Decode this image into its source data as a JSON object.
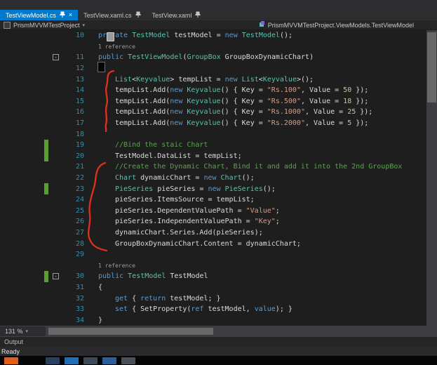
{
  "tabs": [
    {
      "label": "TestViewModel.cs",
      "active": true
    },
    {
      "label": "TestView.xaml.cs",
      "active": false
    },
    {
      "label": "TestView.xaml",
      "active": false
    }
  ],
  "breadcrumb": {
    "project": "PrismMVVMTestProject",
    "context": "PrismMVVMTestProject.ViewModels.TestViewModel"
  },
  "icons": {
    "close": "×",
    "caret": "▾",
    "fold_collapse": "-"
  },
  "editor": {
    "zoom_label": "131 %",
    "rows": [
      {
        "n": "10",
        "i": 0,
        "t": [
          [
            "kw",
            "private"
          ],
          [
            "pl",
            " "
          ],
          [
            "ty",
            "TestModel"
          ],
          [
            "pl",
            " testModel = "
          ],
          [
            "kw",
            "new"
          ],
          [
            "pl",
            " "
          ],
          [
            "ty",
            "TestModel"
          ],
          [
            "pl",
            "();"
          ]
        ]
      },
      {
        "lens": true,
        "i": 0,
        "text": "1 reference"
      },
      {
        "n": "11",
        "i": 0,
        "fold": true,
        "t": [
          [
            "kw",
            "public"
          ],
          [
            "pl",
            " "
          ],
          [
            "ty",
            "TestViewModel"
          ],
          [
            "pl",
            "("
          ],
          [
            "ty",
            "GroupBox"
          ],
          [
            "pl",
            " GroupBoxDynamicChart)"
          ]
        ]
      },
      {
        "n": "12",
        "i": 0,
        "t": [
          [
            "pl",
            "{"
          ]
        ]
      },
      {
        "n": "13",
        "i": 1,
        "t": [
          [
            "ty",
            "List"
          ],
          [
            "pl",
            "<"
          ],
          [
            "ty",
            "Keyvalue"
          ],
          [
            "pl",
            "> tempList = "
          ],
          [
            "kw",
            "new"
          ],
          [
            "pl",
            " "
          ],
          [
            "ty",
            "List"
          ],
          [
            "pl",
            "<"
          ],
          [
            "ty",
            "Keyvalue"
          ],
          [
            "pl",
            ">();"
          ]
        ]
      },
      {
        "n": "14",
        "i": 1,
        "t": [
          [
            "pl",
            "tempList.Add("
          ],
          [
            "kw",
            "new"
          ],
          [
            "pl",
            " "
          ],
          [
            "ty",
            "Keyvalue"
          ],
          [
            "pl",
            "() { Key = "
          ],
          [
            "st",
            "\"Rs.100\""
          ],
          [
            "pl",
            ", Value = "
          ],
          [
            "nu",
            "50"
          ],
          [
            "pl",
            " });"
          ]
        ]
      },
      {
        "n": "15",
        "i": 1,
        "t": [
          [
            "pl",
            "tempList.Add("
          ],
          [
            "kw",
            "new"
          ],
          [
            "pl",
            " "
          ],
          [
            "ty",
            "Keyvalue"
          ],
          [
            "pl",
            "() { Key = "
          ],
          [
            "st",
            "\"Rs.500\""
          ],
          [
            "pl",
            ", Value = "
          ],
          [
            "nu",
            "18"
          ],
          [
            "pl",
            " });"
          ]
        ]
      },
      {
        "n": "16",
        "i": 1,
        "t": [
          [
            "pl",
            "tempList.Add("
          ],
          [
            "kw",
            "new"
          ],
          [
            "pl",
            " "
          ],
          [
            "ty",
            "Keyvalue"
          ],
          [
            "pl",
            "() { Key = "
          ],
          [
            "st",
            "\"Rs.1000\""
          ],
          [
            "pl",
            ", Value = "
          ],
          [
            "nu",
            "25"
          ],
          [
            "pl",
            " });"
          ]
        ]
      },
      {
        "n": "17",
        "i": 1,
        "t": [
          [
            "pl",
            "tempList.Add("
          ],
          [
            "kw",
            "new"
          ],
          [
            "pl",
            " "
          ],
          [
            "ty",
            "Keyvalue"
          ],
          [
            "pl",
            "() { Key = "
          ],
          [
            "st",
            "\"Rs.2000\""
          ],
          [
            "pl",
            ", Value = "
          ],
          [
            "nu",
            "5"
          ],
          [
            "pl",
            " });"
          ]
        ]
      },
      {
        "n": "18",
        "i": 1,
        "t": []
      },
      {
        "n": "19",
        "i": 1,
        "green": true,
        "t": [
          [
            "co",
            "//Bind the staic Chart"
          ]
        ]
      },
      {
        "n": "20",
        "i": 1,
        "green": true,
        "t": [
          [
            "pl",
            "TestModel.DataList = tempList;"
          ]
        ]
      },
      {
        "n": "21",
        "i": 1,
        "t": [
          [
            "co",
            "//Create the Dynamic Chart, Bind it and add it into the 2nd GroupBox"
          ]
        ]
      },
      {
        "n": "22",
        "i": 1,
        "t": [
          [
            "ty",
            "Chart"
          ],
          [
            "pl",
            " dynamicChart = "
          ],
          [
            "kw",
            "new"
          ],
          [
            "pl",
            " "
          ],
          [
            "ty",
            "Chart"
          ],
          [
            "pl",
            "();"
          ]
        ]
      },
      {
        "n": "23",
        "i": 1,
        "green": true,
        "t": [
          [
            "ty",
            "PieSeries"
          ],
          [
            "pl",
            " pieSeries = "
          ],
          [
            "kw",
            "new"
          ],
          [
            "pl",
            " "
          ],
          [
            "ty",
            "PieSeries"
          ],
          [
            "pl",
            "();"
          ]
        ]
      },
      {
        "n": "24",
        "i": 1,
        "t": [
          [
            "pl",
            "pieSeries.ItemsSource = tempList;"
          ]
        ]
      },
      {
        "n": "25",
        "i": 1,
        "t": [
          [
            "pl",
            "pieSeries.DependentValuePath = "
          ],
          [
            "st",
            "\"Value\""
          ],
          [
            "pl",
            ";"
          ]
        ]
      },
      {
        "n": "26",
        "i": 1,
        "t": [
          [
            "pl",
            "pieSeries.IndependentValuePath = "
          ],
          [
            "st",
            "\"Key\""
          ],
          [
            "pl",
            ";"
          ]
        ]
      },
      {
        "n": "27",
        "i": 1,
        "t": [
          [
            "pl",
            "dynamicChart.Series.Add(pieSeries);"
          ]
        ]
      },
      {
        "n": "28",
        "i": 1,
        "t": [
          [
            "pl",
            "GroupBoxDynamicChart.Content = dynamicChart;"
          ]
        ]
      },
      {
        "n": "29",
        "i": 1,
        "t": []
      },
      {
        "lens": true,
        "i": 0,
        "text": "1 reference"
      },
      {
        "n": "30",
        "i": 0,
        "fold": true,
        "green": true,
        "t": [
          [
            "kw",
            "public"
          ],
          [
            "pl",
            " "
          ],
          [
            "ty",
            "TestModel"
          ],
          [
            "pl",
            " TestModel"
          ]
        ]
      },
      {
        "n": "31",
        "i": 0,
        "t": [
          [
            "pl",
            "{"
          ]
        ]
      },
      {
        "n": "32",
        "i": 1,
        "t": [
          [
            "kw",
            "get"
          ],
          [
            "pl",
            " { "
          ],
          [
            "kw",
            "return"
          ],
          [
            "pl",
            " testModel; }"
          ]
        ]
      },
      {
        "n": "33",
        "i": 1,
        "t": [
          [
            "kw",
            "set"
          ],
          [
            "pl",
            " { SetProperty("
          ],
          [
            "kw",
            "ref"
          ],
          [
            "pl",
            " testModel, "
          ],
          [
            "kw",
            "value"
          ],
          [
            "pl",
            "); }"
          ]
        ]
      },
      {
        "n": "34",
        "i": 0,
        "t": [
          [
            "pl",
            "}"
          ]
        ]
      }
    ]
  },
  "output_label": "Output",
  "status_label": "Ready",
  "taskbar": {
    "icons": [
      {
        "name": "taskbar-app-orange",
        "color": "#E05E17"
      },
      {
        "name": "taskbar-app-1",
        "color": "#27415e"
      },
      {
        "name": "taskbar-app-2",
        "color": "#1f6fb4"
      },
      {
        "name": "taskbar-app-3",
        "color": "#3d4a57"
      },
      {
        "name": "taskbar-app-4",
        "color": "#2a5f9e"
      },
      {
        "name": "taskbar-app-5",
        "color": "#49505a"
      }
    ]
  }
}
